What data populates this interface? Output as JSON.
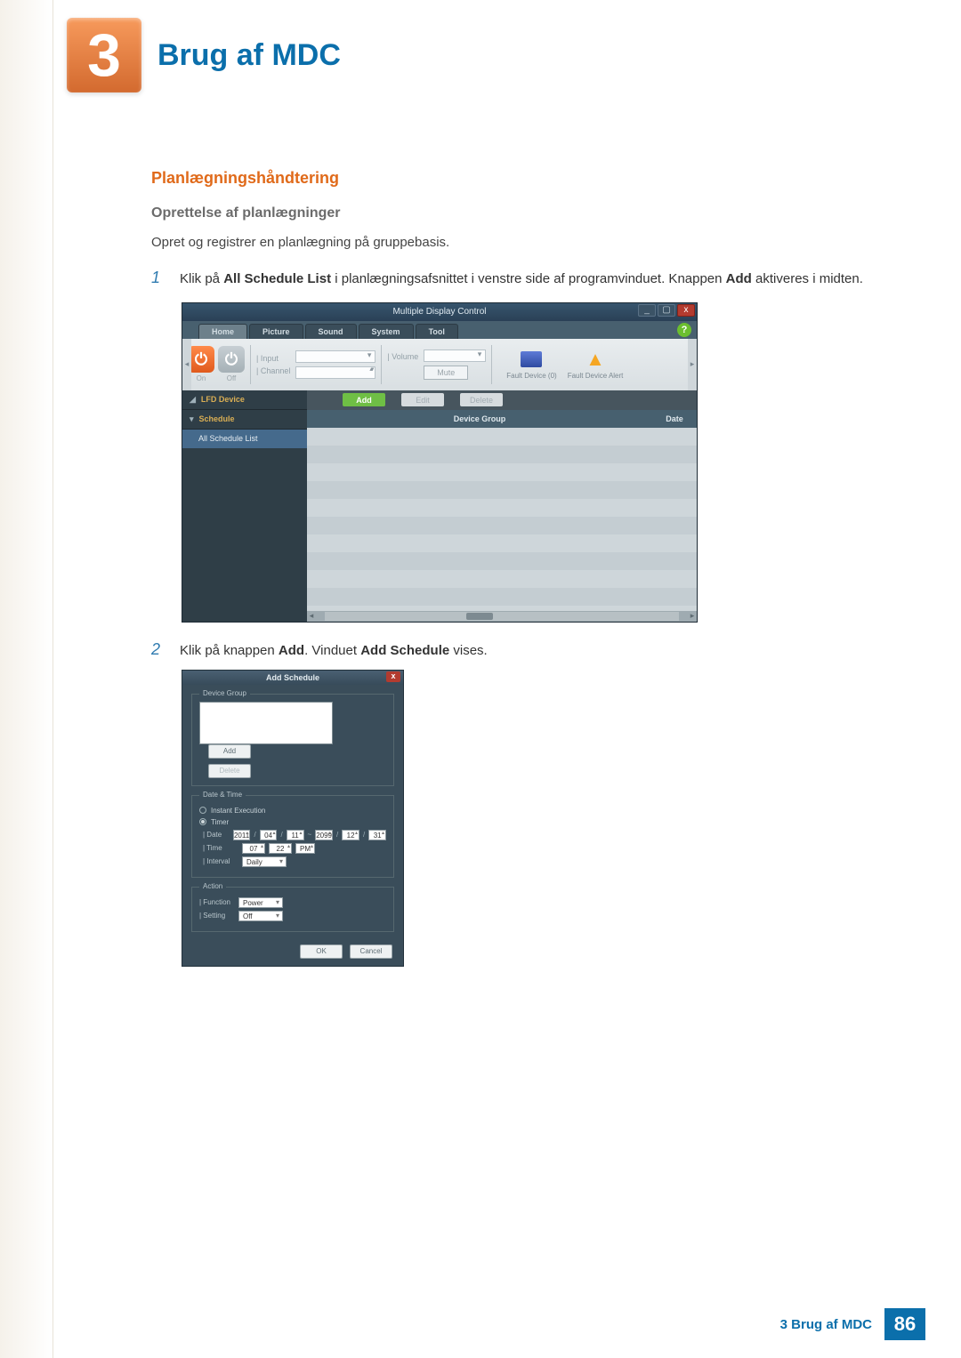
{
  "chapter": {
    "number": "3",
    "title": "Brug af MDC"
  },
  "section": {
    "h3": "Planlægningshåndtering",
    "h4": "Oprettelse af planlægninger",
    "intro": "Opret og registrer en planlægning på gruppebasis."
  },
  "steps": {
    "s1_num": "1",
    "s1_a": "Klik på ",
    "s1_b": "All Schedule List",
    "s1_c": " i planlægningsafsnittet i venstre side af programvinduet. Knappen ",
    "s1_d": "Add",
    "s1_e": " aktiveres i midten.",
    "s2_num": "2",
    "s2_a": "Klik på knappen ",
    "s2_b": "Add",
    "s2_c": ". Vinduet ",
    "s2_d": "Add Schedule",
    "s2_e": " vises."
  },
  "app": {
    "title": "Multiple Display Control",
    "help": "?",
    "win": {
      "min": "_",
      "max": "▢",
      "close": "x"
    },
    "tabs": {
      "home": "Home",
      "picture": "Picture",
      "sound": "Sound",
      "system": "System",
      "tool": "Tool"
    },
    "power": {
      "on": "On",
      "off": "Off",
      "glyph": "⏻"
    },
    "input_lbl": "| Input",
    "channel_lbl": "| Channel",
    "volume_lbl": "| Volume",
    "mute": "Mute",
    "fault_device": "Fault Device (0)",
    "fault_alert": "Fault Device Alert",
    "side": {
      "lfd": "LFD Device",
      "schedule": "Schedule",
      "all_list": "All Schedule List"
    },
    "actions": {
      "add": "Add",
      "edit": "Edit",
      "delete": "Delete"
    },
    "grid": {
      "group": "Device Group",
      "date": "Date"
    }
  },
  "dialog": {
    "title": "Add Schedule",
    "close": "x",
    "device_group": "Device Group",
    "add": "Add",
    "delete": "Delete",
    "date_time": "Date & Time",
    "instant": "Instant Execution",
    "timer": "Timer",
    "row_date": "| Date",
    "row_time": "| Time",
    "row_interval": "| Interval",
    "date": {
      "y1": "2011",
      "m1": "04",
      "d1": "11",
      "tilde": "~",
      "y2": "2099",
      "m2": "12",
      "d2": "31",
      "slash": "/"
    },
    "time": {
      "h": "07",
      "m": "22",
      "ap": "PM"
    },
    "interval": "Daily",
    "action": "Action",
    "row_function": "| Function",
    "row_setting": "| Setting",
    "function": "Power",
    "setting": "Off",
    "ok": "OK",
    "cancel": "Cancel"
  },
  "footer": {
    "text": "3 Brug af MDC",
    "page": "86"
  }
}
